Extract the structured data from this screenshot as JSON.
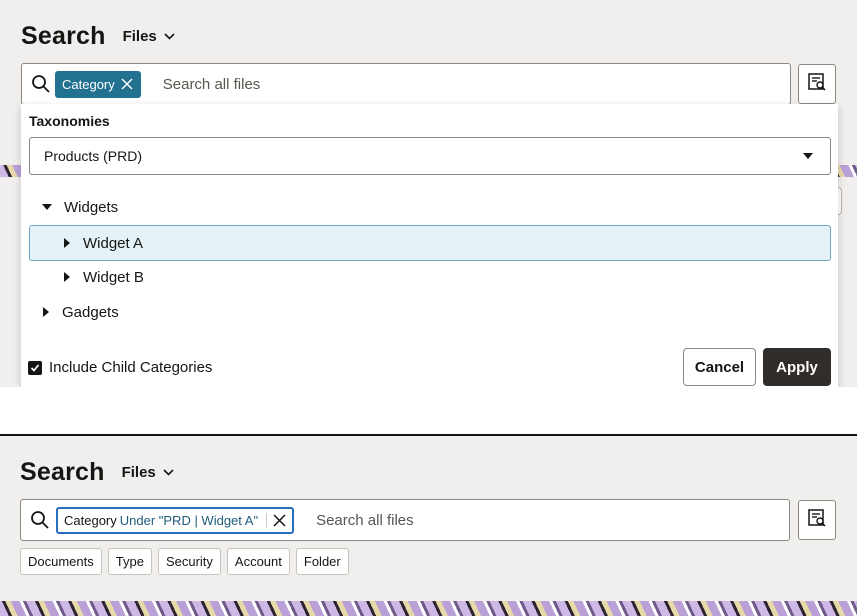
{
  "colors": {
    "page_bg": "#f1efed",
    "chip_teal": "#227190",
    "apply_bg": "#312d2a",
    "selected_row_bg": "#e4f1f7",
    "chip_focus_border": "#2a6fbf"
  },
  "panel_a": {
    "title": "Search",
    "scope": {
      "label": "Files",
      "icon": "chevron-down-icon"
    },
    "search": {
      "icon": "search-icon",
      "chip": {
        "label": "Category",
        "remove_icon": "close-icon"
      },
      "placeholder": "Search all files"
    },
    "advanced_search_icon": "advanced-search-icon",
    "dropdown": {
      "taxonomies_label": "Taxonomies",
      "taxonomy_selected": "Products (PRD)",
      "tree": [
        {
          "label": "Widgets",
          "expanded": true,
          "level": 0
        },
        {
          "label": "Widget A",
          "expanded": false,
          "level": 1,
          "selected": true
        },
        {
          "label": "Widget B",
          "expanded": false,
          "level": 1
        },
        {
          "label": "Gadgets",
          "expanded": false,
          "level": 0
        }
      ],
      "include_child": {
        "label": "Include Child Categories",
        "checked": true
      },
      "cancel_label": "Cancel",
      "apply_label": "Apply"
    }
  },
  "panel_b": {
    "title": "Search",
    "scope": {
      "label": "Files",
      "icon": "chevron-down-icon"
    },
    "search": {
      "icon": "search-icon",
      "chip": {
        "category": "Category",
        "value": "Under \"PRD | Widget A\"",
        "remove_icon": "close-icon"
      },
      "placeholder": "Search all files"
    },
    "advanced_search_icon": "advanced-search-icon",
    "filters": [
      "Documents",
      "Type",
      "Security",
      "Account",
      "Folder"
    ]
  }
}
